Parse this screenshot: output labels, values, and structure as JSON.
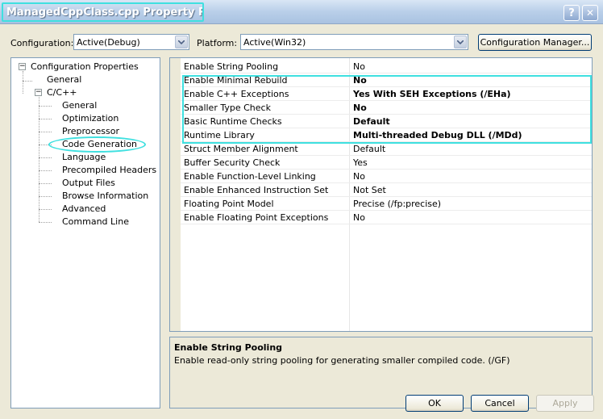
{
  "window": {
    "title": "ManagedCppClass.cpp Property Pages",
    "help_glyph": "?",
    "close_glyph": "✕"
  },
  "config": {
    "configuration_label": "Configuration:",
    "configuration_value": "Active(Debug)",
    "platform_label": "Platform:",
    "platform_value": "Active(Win32)",
    "manager_button": "Configuration Manager..."
  },
  "tree": {
    "root": "Configuration Properties",
    "general": "General",
    "cpp": "C/C++",
    "children": [
      "General",
      "Optimization",
      "Preprocessor",
      "Code Generation",
      "Language",
      "Precompiled Headers",
      "Output Files",
      "Browse Information",
      "Advanced",
      "Command Line"
    ],
    "selected": "Code Generation"
  },
  "properties": [
    {
      "name": "Enable String Pooling",
      "value": "No",
      "bold": false
    },
    {
      "name": "Enable Minimal Rebuild",
      "value": "No",
      "bold": true
    },
    {
      "name": "Enable C++ Exceptions",
      "value": "Yes With SEH Exceptions (/EHa)",
      "bold": true
    },
    {
      "name": "Smaller Type Check",
      "value": "No",
      "bold": true
    },
    {
      "name": "Basic Runtime Checks",
      "value": "Default",
      "bold": true
    },
    {
      "name": "Runtime Library",
      "value": "Multi-threaded Debug DLL (/MDd)",
      "bold": true
    },
    {
      "name": "Struct Member Alignment",
      "value": "Default",
      "bold": false
    },
    {
      "name": "Buffer Security Check",
      "value": "Yes",
      "bold": false
    },
    {
      "name": "Enable Function-Level Linking",
      "value": "No",
      "bold": false
    },
    {
      "name": "Enable Enhanced Instruction Set",
      "value": "Not Set",
      "bold": false
    },
    {
      "name": "Floating Point Model",
      "value": "Precise (/fp:precise)",
      "bold": false
    },
    {
      "name": "Enable Floating Point Exceptions",
      "value": "No",
      "bold": false
    }
  ],
  "description": {
    "title": "Enable String Pooling",
    "text": "Enable read-only string pooling for generating smaller compiled code.     (/GF)"
  },
  "buttons": {
    "ok": "OK",
    "cancel": "Cancel",
    "apply": "Apply"
  },
  "colors": {
    "highlight": "#3fe0e0",
    "border": "#7f9db9"
  }
}
